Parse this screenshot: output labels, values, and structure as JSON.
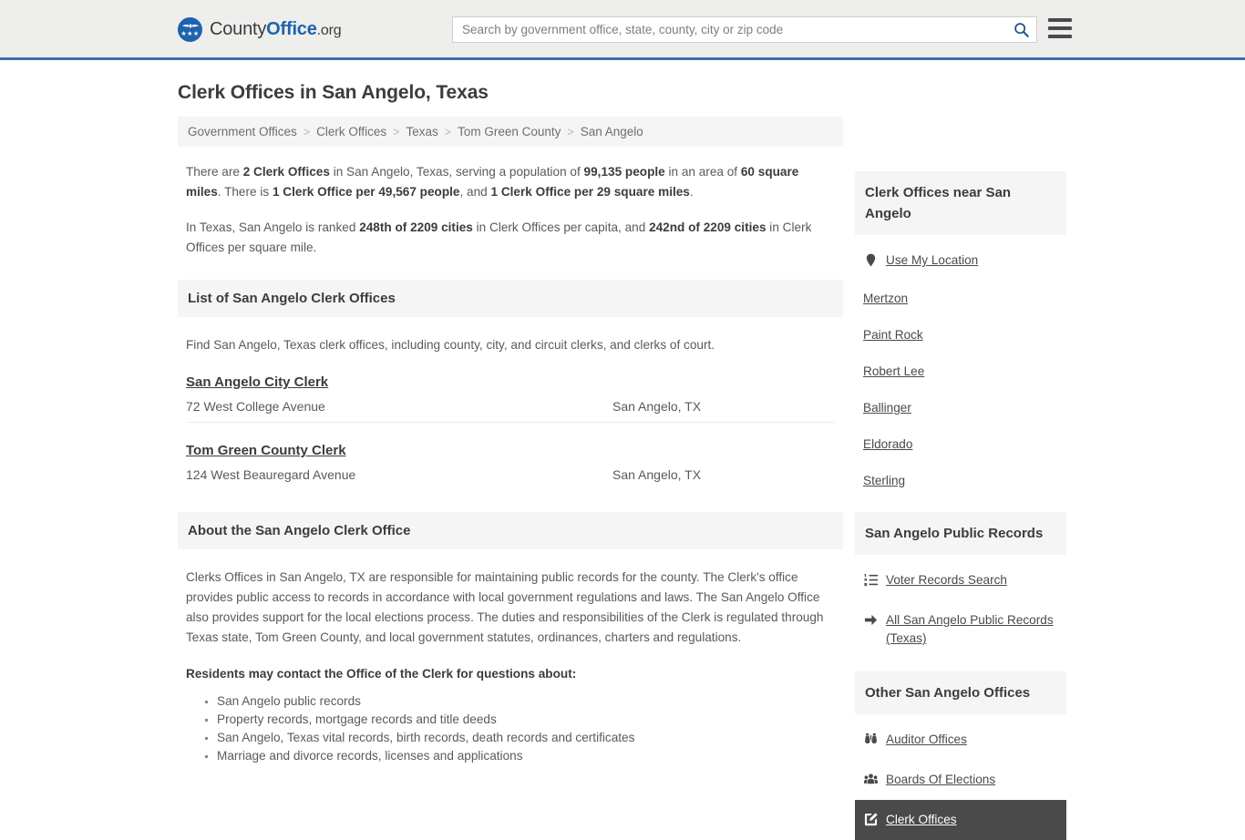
{
  "header": {
    "brand": {
      "part1": "County",
      "part2": "Office",
      "part3": ".org"
    },
    "search": {
      "placeholder": "Search by government office, state, county, city or zip code",
      "value": "",
      "button_label": "search-icon"
    },
    "menu_label": "menu-icon"
  },
  "main": {
    "title": "Clerk Offices in San Angelo, Texas",
    "breadcrumb": [
      "Government Offices",
      "Clerk Offices",
      "Texas",
      "Tom Green County",
      "San Angelo"
    ],
    "breadcrumb_separator": ">",
    "intro": {
      "p1": [
        {
          "t": "There are ",
          "b": false
        },
        {
          "t": "2 Clerk Offices",
          "b": true
        },
        {
          "t": " in San Angelo, Texas, serving a population of ",
          "b": false
        },
        {
          "t": "99,135 people",
          "b": true
        },
        {
          "t": " in an area of ",
          "b": false
        },
        {
          "t": "60 square miles",
          "b": true
        },
        {
          "t": ". There is ",
          "b": false
        },
        {
          "t": "1 Clerk Office per 49,567 people",
          "b": true
        },
        {
          "t": ", and ",
          "b": false
        },
        {
          "t": "1 Clerk Office per 29 square miles",
          "b": true
        },
        {
          "t": ".",
          "b": false
        }
      ],
      "p2": [
        {
          "t": "In Texas, San Angelo is ranked ",
          "b": false
        },
        {
          "t": "248th of 2209 cities",
          "b": true
        },
        {
          "t": " in Clerk Offices per capita, and ",
          "b": false
        },
        {
          "t": "242nd of 2209 cities",
          "b": true
        },
        {
          "t": " in Clerk Offices per square mile.",
          "b": false
        }
      ]
    },
    "list_section": {
      "heading": "List of San Angelo Clerk Offices",
      "lead": "Find San Angelo, Texas clerk offices, including county, city, and circuit clerks, and clerks of court.",
      "offices": [
        {
          "name": "San Angelo City Clerk",
          "address": "72 West College Avenue",
          "city_state": "San Angelo, TX"
        },
        {
          "name": "Tom Green County Clerk",
          "address": "124 West Beauregard Avenue",
          "city_state": "San Angelo, TX"
        }
      ]
    },
    "about_section": {
      "heading": "About the San Angelo Clerk Office",
      "paragraph": "Clerks Offices in San Angelo, TX are responsible for maintaining public records for the county. The Clerk's office provides public access to records in accordance with local government regulations and laws. The San Angelo Office also provides support for the local elections process. The duties and responsibilities of the Clerk is regulated through Texas state, Tom Green County, and local government statutes, ordinances, charters and regulations.",
      "question_heading": "Residents may contact the Office of the Clerk for questions about:",
      "bullets": [
        "San Angelo public records",
        "Property records, mortgage records and title deeds",
        "San Angelo, Texas vital records, birth records, death records and certificates",
        "Marriage and divorce records, licenses and applications"
      ]
    }
  },
  "sidebar": {
    "nearby": {
      "heading": "Clerk Offices near San Angelo",
      "items": [
        {
          "label": "Use My Location",
          "icon": "map-pin-icon"
        },
        {
          "label": "Mertzon",
          "icon": ""
        },
        {
          "label": "Paint Rock",
          "icon": ""
        },
        {
          "label": "Robert Lee",
          "icon": ""
        },
        {
          "label": "Ballinger",
          "icon": ""
        },
        {
          "label": "Eldorado",
          "icon": ""
        },
        {
          "label": "Sterling",
          "icon": ""
        }
      ]
    },
    "public_records": {
      "heading": "San Angelo Public Records",
      "items": [
        {
          "label": "Voter Records Search",
          "icon": "ordered-list-icon"
        },
        {
          "label": "All San Angelo Public Records (Texas)",
          "icon": "arrow-right-icon"
        }
      ]
    },
    "other_offices": {
      "heading": "Other San Angelo Offices",
      "items": [
        {
          "label": "Auditor Offices",
          "icon": "binoculars-icon",
          "active": false
        },
        {
          "label": "Boards Of Elections",
          "icon": "people-group-icon",
          "active": false
        },
        {
          "label": "Clerk Offices",
          "icon": "edit-square-icon",
          "active": true
        }
      ]
    }
  },
  "colors": {
    "header_bg": "#eeeeec",
    "header_border": "#3573ab",
    "brand_blue": "#1e63ad",
    "panel_bg": "#f5f5f5",
    "text": "#4a4a4a",
    "active_bg": "#4a4a4a"
  }
}
